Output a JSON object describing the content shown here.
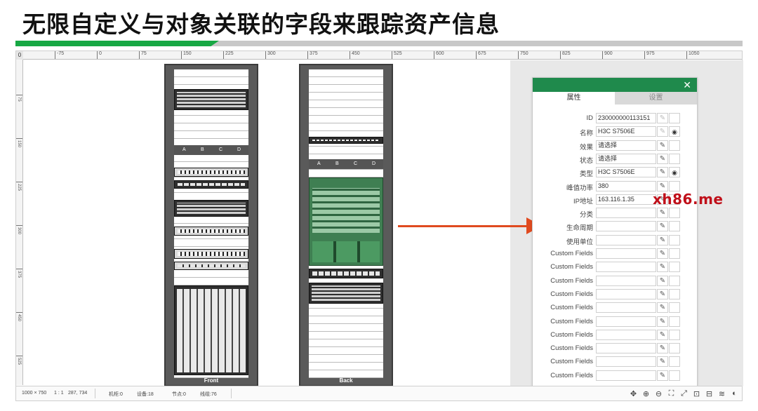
{
  "slide": {
    "title": "无限自定义与对象关联的字段来跟踪资产信息"
  },
  "ruler": {
    "corner": "0",
    "h_labels": [
      "-75",
      "0",
      "75",
      "150",
      "225",
      "300",
      "375",
      "450",
      "525",
      "600",
      "675",
      "750",
      "825",
      "900",
      "975",
      "1050"
    ],
    "v_labels": [
      "75",
      "150",
      "225",
      "300",
      "375",
      "450",
      "525"
    ]
  },
  "racks": {
    "front": {
      "caption": "Front",
      "pdu_labels": [
        "A",
        "B",
        "C",
        "D"
      ]
    },
    "back": {
      "caption": "Back",
      "pdu_labels": [
        "A",
        "B",
        "C",
        "D"
      ]
    }
  },
  "panel": {
    "tabs": [
      {
        "label": "属性",
        "active": true
      },
      {
        "label": "设置",
        "active": false
      }
    ],
    "close_icon": "close-icon",
    "fields": [
      {
        "label": "ID",
        "value": "230000000113151",
        "eye": false
      },
      {
        "label": "名称",
        "value": "H3C S7506E",
        "eye": true
      },
      {
        "label": "效果",
        "value": "请选择",
        "eye": false
      },
      {
        "label": "状态",
        "value": "请选择",
        "eye": false
      },
      {
        "label": "类型",
        "value": "H3C S7506E",
        "eye": true
      },
      {
        "label": "峰值功率",
        "value": "380",
        "eye": false
      },
      {
        "label": "IP地址",
        "value": "163.116.1.35",
        "eye": false
      },
      {
        "label": "分类",
        "value": "",
        "eye": false
      },
      {
        "label": "生命周期",
        "value": "",
        "eye": false
      },
      {
        "label": "使用单位",
        "value": "",
        "eye": false
      },
      {
        "label": "Custom Fields",
        "value": "",
        "eye": false
      },
      {
        "label": "Custom Fields",
        "value": "",
        "eye": false
      },
      {
        "label": "Custom Fields",
        "value": "",
        "eye": false
      },
      {
        "label": "Custom Fields",
        "value": "",
        "eye": false
      },
      {
        "label": "Custom Fields",
        "value": "",
        "eye": false
      },
      {
        "label": "Custom Fields",
        "value": "",
        "eye": false
      },
      {
        "label": "Custom Fields",
        "value": "",
        "eye": false
      },
      {
        "label": "Custom Fields",
        "value": "",
        "eye": false
      },
      {
        "label": "Custom Fields",
        "value": "",
        "eye": false
      },
      {
        "label": "Custom Fields",
        "value": "",
        "eye": false
      }
    ],
    "edit_glyph": "✎",
    "eye_glyph": "◉"
  },
  "watermark": "xh86.me",
  "status": {
    "size": "1000 × 750",
    "scale": "1 : 1",
    "coords": "287, 734",
    "racks": "机柜:0",
    "devices": "设备:18",
    "nodes": "节点:0",
    "lines": "线缆:76"
  },
  "toolbar_icons": [
    "move-icon",
    "zoom-in-icon",
    "zoom-out-icon",
    "fit-icon",
    "fullscreen-icon",
    "export-icon",
    "grid-icon",
    "layers-icon",
    "settings-icon"
  ],
  "toolbar_glyphs": [
    "✥",
    "⊕",
    "⊖",
    "⛶",
    "⤢",
    "⊡",
    "⊟",
    "≋",
    "◐"
  ],
  "colors": {
    "accent": "#1f8a4c",
    "title_accent": "#17a844",
    "arrow": "#e04a1f",
    "watermark": "#c0101a"
  }
}
